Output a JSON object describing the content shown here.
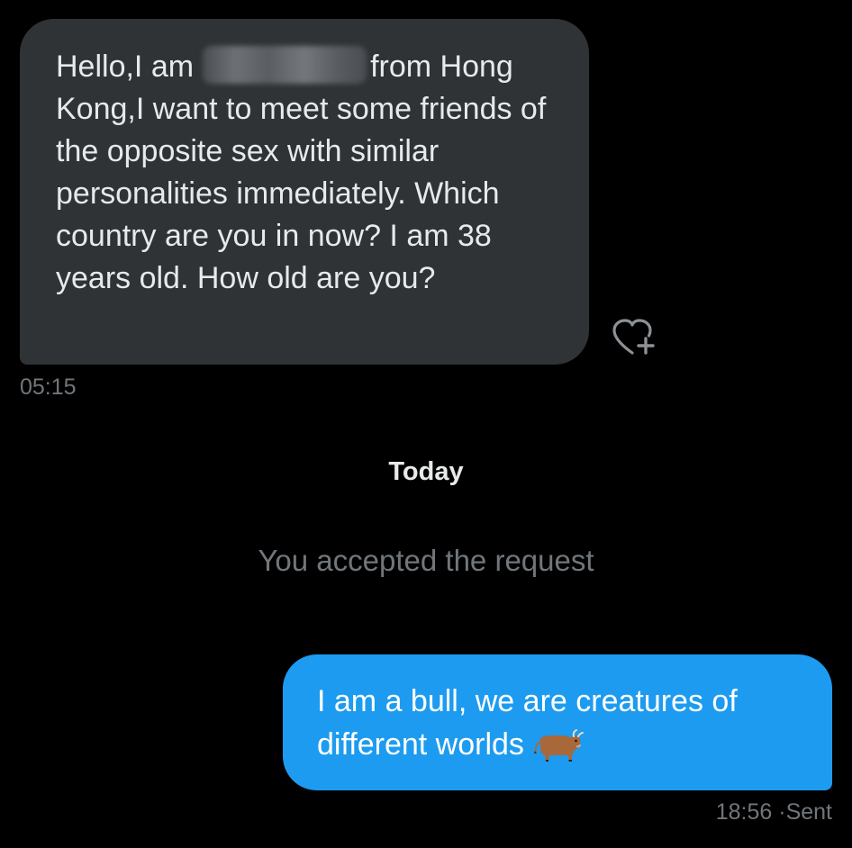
{
  "incoming_message": {
    "text_before_name": "Hello,I am",
    "text_after_name": "from Hong Kong,I want to meet some friends of the opposite sex with similar personalities immediately. Which country are you in now? I am 38 years old. How old are you?",
    "time": "05:15"
  },
  "react_button_icon": "heart-plus-icon",
  "date_divider": "Today",
  "system_message": "You accepted the request",
  "outgoing_message": {
    "text": "I am a bull, we are creatures of different worlds",
    "emoji_icon": "ox-emoji",
    "time": "18:56",
    "separator": "·",
    "status": "Sent"
  },
  "colors": {
    "background": "#000000",
    "incoming_bubble": "#2f3336",
    "outgoing_bubble": "#1d9bf0",
    "secondary_text": "#71767b",
    "primary_text": "#e7e9ea"
  }
}
